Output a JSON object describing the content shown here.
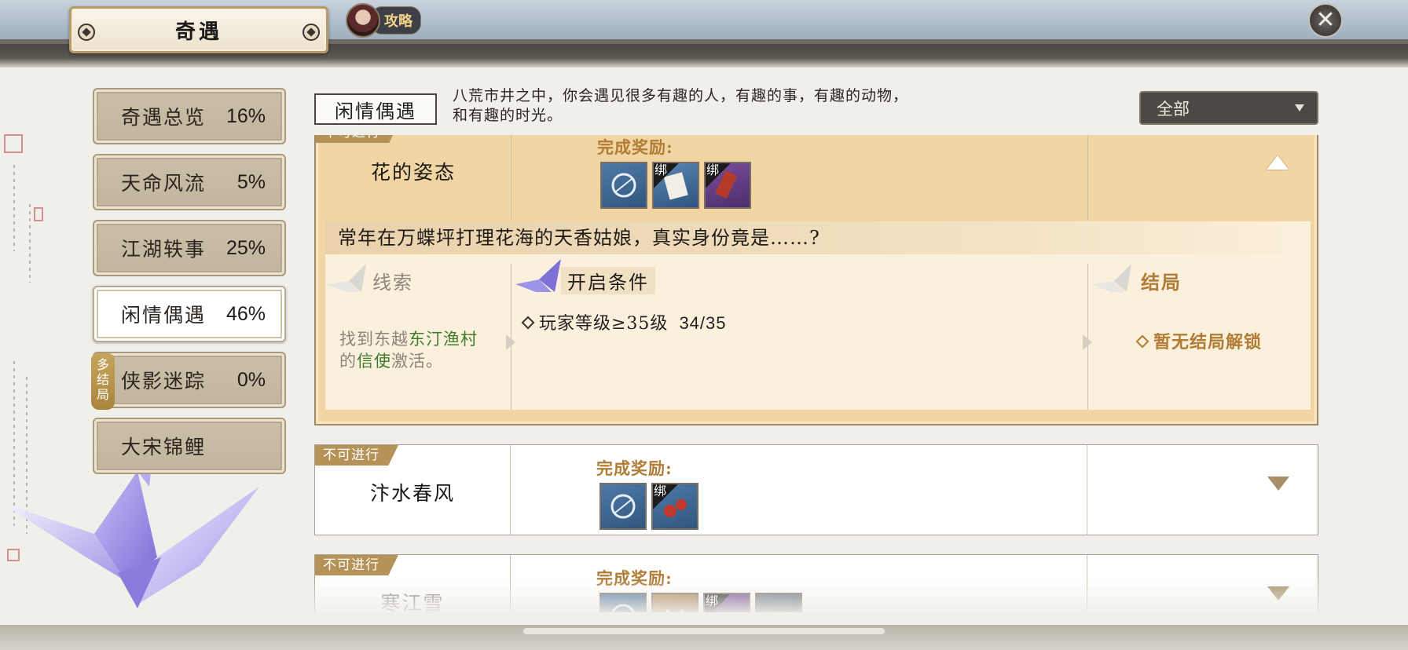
{
  "header": {
    "title": "奇遇",
    "guide_label": "攻略",
    "close_icon": "close-icon"
  },
  "sidebar": {
    "items": [
      {
        "name": "奇遇总览",
        "pct": "16%",
        "active": false
      },
      {
        "name": "天命风流",
        "pct": "5%",
        "active": false
      },
      {
        "name": "江湖轶事",
        "pct": "25%",
        "active": false
      },
      {
        "name": "闲情偶遇",
        "pct": "46%",
        "active": true
      },
      {
        "name": "侠影迷踪",
        "pct": "0%",
        "active": false,
        "badge": "多结局"
      },
      {
        "name": "大宋锦鲤",
        "pct": "",
        "active": false
      }
    ]
  },
  "category": {
    "label": "闲情偶遇",
    "description_line1": "八荒市井之中，你会遇见很多有趣的人，有趣的事，有趣的动物，",
    "description_line2": "和有趣的时光。"
  },
  "filter": {
    "selected": "全部"
  },
  "events": [
    {
      "status": "不可进行",
      "name": "花的姿态",
      "reward_label": "完成奖励:",
      "expanded": true,
      "rewards": [
        {
          "icon": "ring-icon",
          "bound": false,
          "bind_text": ""
        },
        {
          "icon": "letter-icon",
          "bound": true,
          "bind_text": "绑"
        },
        {
          "icon": "scroll-icon",
          "bound": true,
          "bind_text": "绑"
        }
      ],
      "detail": {
        "title": "常年在万蝶坪打理花海的天香姑娘，真实身份竟是……?",
        "clue_head": "线索",
        "clue_pre1": "找到东越",
        "clue_hl1": "东汀渔村",
        "clue_pre2": "的",
        "clue_hl2": "信使",
        "clue_post": "激活。",
        "cond_head": "开启条件",
        "cond_text": "玩家等级≥35级",
        "cond_value": "34/35",
        "end_head": "结局",
        "end_text": "暂无结局解锁"
      }
    },
    {
      "status": "不可进行",
      "name": "汴水春风",
      "reward_label": "完成奖励:",
      "expanded": false,
      "rewards": [
        {
          "icon": "ring-icon",
          "bound": false,
          "bind_text": ""
        },
        {
          "icon": "ornament-icon",
          "bound": true,
          "bind_text": "绑"
        }
      ]
    },
    {
      "status": "不可进行",
      "name": "寒江雪",
      "reward_label": "完成奖励:",
      "expanded": false,
      "rewards": [
        {
          "icon": "ring-icon",
          "bound": false,
          "bind_text": ""
        },
        {
          "icon": "crown-icon",
          "bound": false,
          "bind_text": ""
        },
        {
          "icon": "scroll-icon",
          "bound": true,
          "bind_text": "绑"
        },
        {
          "icon": "bag-icon",
          "bound": false,
          "bind_text": ""
        }
      ]
    }
  ],
  "colors": {
    "reward_gold": "#b07c36",
    "highlight_green": "#3f7b2e",
    "expanded_bg": "#f1d5a3"
  }
}
